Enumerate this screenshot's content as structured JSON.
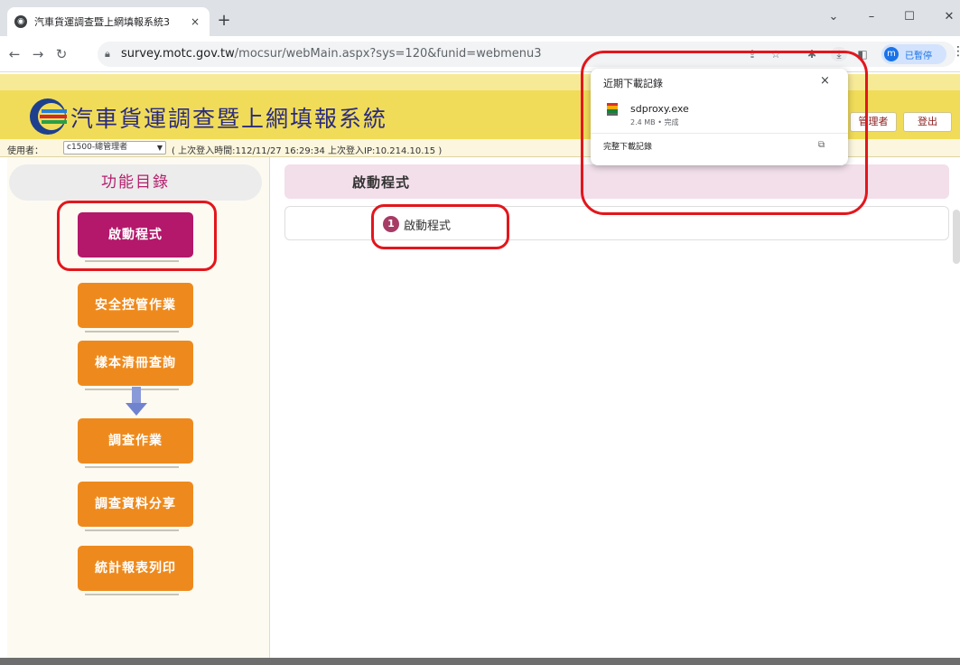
{
  "browser": {
    "tab_title": "汽車貨運調查暨上網填報系統3",
    "tab_close": "×",
    "new_tab": "+",
    "url_host": "survey.motc.gov.tw",
    "url_path": "/mocsur/webMain.aspx?sys=120&funid=webmenu3",
    "profile_initial": "m",
    "profile_label": "已暫停",
    "window_minimize": "–",
    "window_maximize": "☐",
    "window_close": "✕",
    "dropdown": "⌄"
  },
  "downloads": {
    "title": "近期下載記錄",
    "close": "×",
    "file_name": "sdproxy.exe",
    "file_status": "2.4 MB • 完成",
    "show_all": "完整下載記錄",
    "open_icon": "⧉"
  },
  "header": {
    "site_title": "汽車貨運調查暨上網填報系統",
    "admin_button": "管理者",
    "logout_button": "登出"
  },
  "user_bar": {
    "label": "使用者：",
    "user_value": "c1500-總管理者",
    "login_info": "( 上次登入時間:112/11/27 16:29:34 上次登入IP:10.214.10.15 )"
  },
  "sidebar": {
    "title": "功能目錄",
    "items": [
      {
        "label": "啟動程式"
      },
      {
        "label": "安全控管作業"
      },
      {
        "label": "樣本清冊查詢"
      },
      {
        "label": "調查作業"
      },
      {
        "label": "調查資料分享"
      },
      {
        "label": "統計報表列印"
      }
    ]
  },
  "main": {
    "title": "啟動程式",
    "step_number": "1",
    "step_label": "啟動程式"
  },
  "colors": {
    "header_yellow": "#f0dc58",
    "menu_orange": "#ee8a1d",
    "menu_active": "#b3186b",
    "highlight_red": "#e3161c"
  }
}
